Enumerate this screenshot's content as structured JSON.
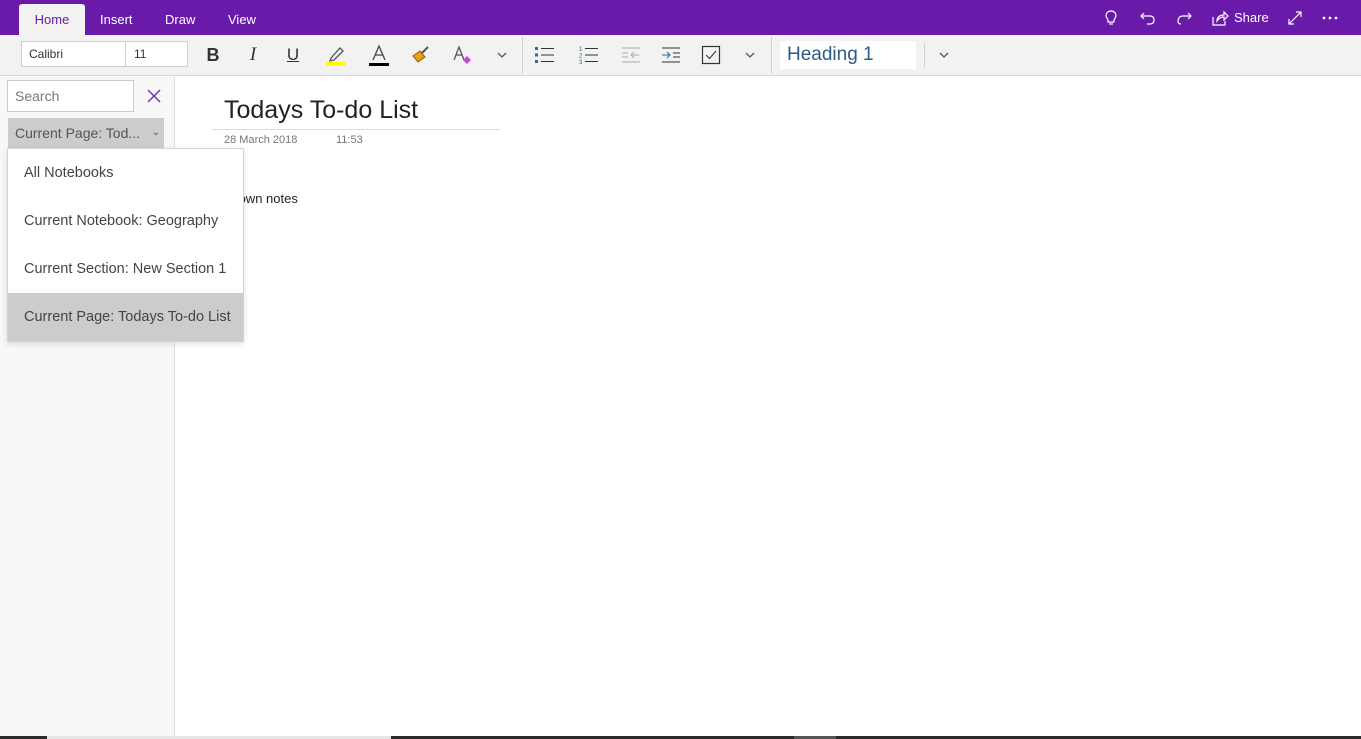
{
  "tabs": [
    {
      "label": "Home",
      "active": true
    },
    {
      "label": "Insert",
      "active": false
    },
    {
      "label": "Draw",
      "active": false
    },
    {
      "label": "View",
      "active": false
    }
  ],
  "titlebar": {
    "share_label": "Share",
    "icons": [
      "lightbulb-icon",
      "undo-icon",
      "redo-icon",
      "share-icon",
      "expand-icon",
      "more-icon"
    ]
  },
  "ribbon": {
    "font_name": "Calibri",
    "font_size": "11",
    "style": "Heading 1",
    "highlight_color": "#ffff00",
    "font_color": "#000000"
  },
  "search": {
    "placeholder": "Search",
    "scope_selected": "Current Page: Tod...",
    "scope_options": [
      "All Notebooks",
      "Current Notebook: Geography",
      "Current Section: New Section 1",
      "Current Page: Todays To-do List"
    ],
    "selected_index": 3
  },
  "page": {
    "title": "Todays To-do List",
    "date": "28 March 2018",
    "time": "11:53",
    "note": "ke down notes"
  },
  "colors": {
    "accent": "#6a1aa8"
  }
}
